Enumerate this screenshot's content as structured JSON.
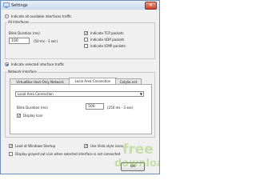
{
  "window": {
    "title": "Settings"
  },
  "all_interfaces": {
    "radio_label": "Indicate all available interfaces traffic",
    "group_label": "All Interfaces",
    "blink_label": "Blink Duration (ms)",
    "blink_value": "100",
    "blink_range": "(50 ms - 3 sec)",
    "tcp_label": "Indicate TCP packets",
    "udp_label": "Indicate UDP packets",
    "icmp_label": "Indicate ICMP packets",
    "tcp_checked": true,
    "udp_checked": false,
    "icmp_checked": false
  },
  "selected_interface": {
    "radio_label": "Indicate selected interface traffic",
    "group_label": "Network Interface",
    "tabs": [
      "VirtualBox Host-Only Network",
      "Local Area Connection",
      "Catylia.net"
    ],
    "active_tab": "Local Area Connection",
    "select_value": "Local Area Connection",
    "blink_label": "Blink Duration (ms)",
    "blink_value": "500",
    "blink_range": "(250 ms - 3 sec)",
    "display_icon_label": "Display Icon",
    "display_icon_checked": true
  },
  "options": {
    "load_startup_label": "Load at Windows Startup",
    "vista_icons_label": "Use Vista style icons",
    "grayed_icon_label": "Display grayed out icon when selected interface is not connected",
    "load_startup_checked": true,
    "vista_icons_checked": true,
    "grayed_icon_checked": false
  },
  "buttons": {
    "ok_label": "OK"
  },
  "watermark": {
    "line1": "free",
    "line2": "download"
  }
}
